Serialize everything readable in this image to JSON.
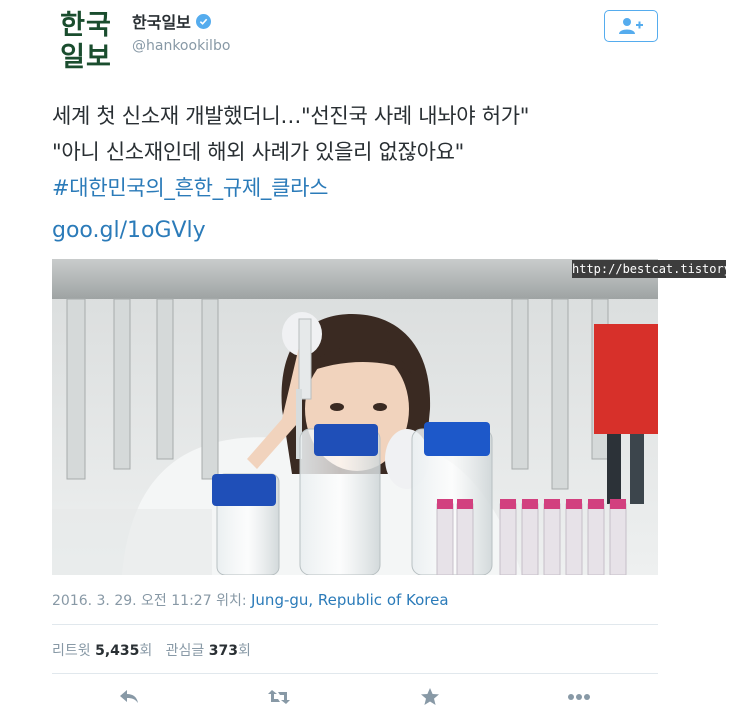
{
  "account": {
    "avatar_line1": "한국",
    "avatar_line2": "일보",
    "display_name": "한국일보",
    "handle": "@hankookilbo",
    "verified_icon": "verified-badge-icon",
    "follow_icon": "follow-user-icon"
  },
  "tweet": {
    "line1": "세계 첫 신소재 개발했더니…\"선진국 사례 내놔야 허가\"",
    "line2": "\"아니 신소재인데 해외 사례가 있을리 없잖아요\"",
    "hashtag": "#대한민국의_흔한_규제_클라스",
    "link": "goo.gl/1oGVly"
  },
  "photo": {
    "watermark": "http://bestcat.tistory.com"
  },
  "meta": {
    "timestamp": "2016. 3. 29. 오전 11:27",
    "location_label": "위치:",
    "location": "Jung-gu, Republic of Korea"
  },
  "stats": {
    "retweet_label": "리트윗",
    "retweet_count": "5,435",
    "retweet_unit": "회",
    "like_label": "관심글",
    "like_count": "373",
    "like_unit": "회"
  },
  "actions": {
    "reply_icon": "reply-icon",
    "retweet_icon": "retweet-icon",
    "favorite_icon": "star-icon",
    "more_icon": "more-icon"
  },
  "colors": {
    "link": "#2b7bb9",
    "accent": "#55acee",
    "muted": "#8899a6",
    "brand_green": "#1a4d2e"
  }
}
